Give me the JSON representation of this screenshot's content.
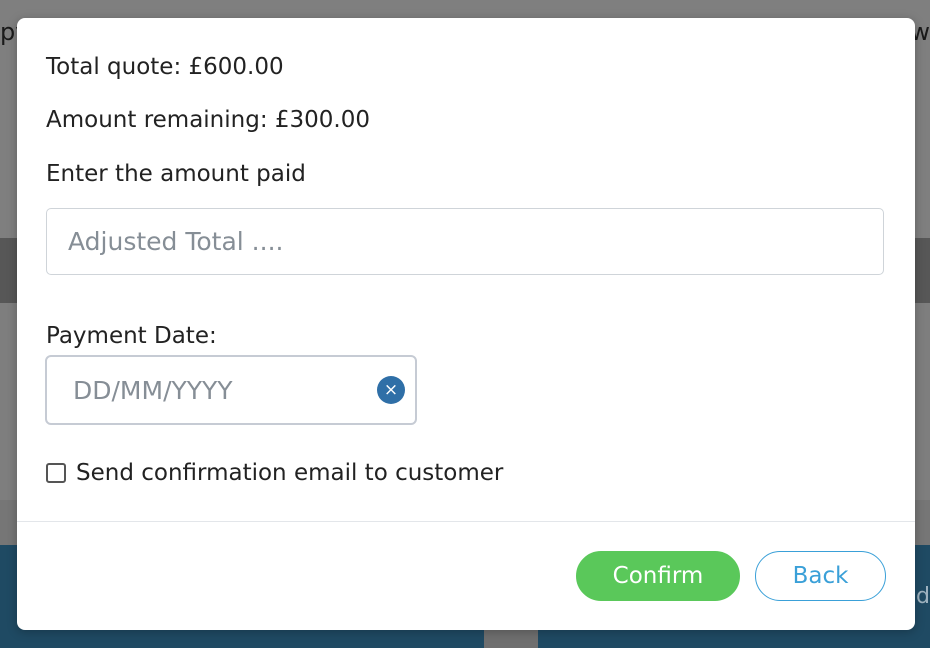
{
  "background": {
    "left_fragment": "py",
    "right_fragment": "w",
    "bottom_right_fragment": "d"
  },
  "modal": {
    "total_quote": "Total quote: £600.00",
    "amount_remaining": "Amount remaining: £300.00",
    "amount_prompt": "Enter the amount paid",
    "amount_input": {
      "value": "",
      "placeholder": "Adjusted Total ...."
    },
    "payment_date_label": "Payment Date:",
    "payment_date_input": {
      "value": "",
      "placeholder": "DD/MM/YYYY"
    },
    "clear_icon_glyph": "×",
    "send_email_checkbox": {
      "checked": false,
      "label": "Send confirmation email to customer"
    },
    "buttons": {
      "confirm": "Confirm",
      "back": "Back"
    }
  },
  "colors": {
    "confirm_green": "#5ac85a",
    "back_blue": "#3aa0d8",
    "clear_icon_blue": "#2f6fa7"
  }
}
